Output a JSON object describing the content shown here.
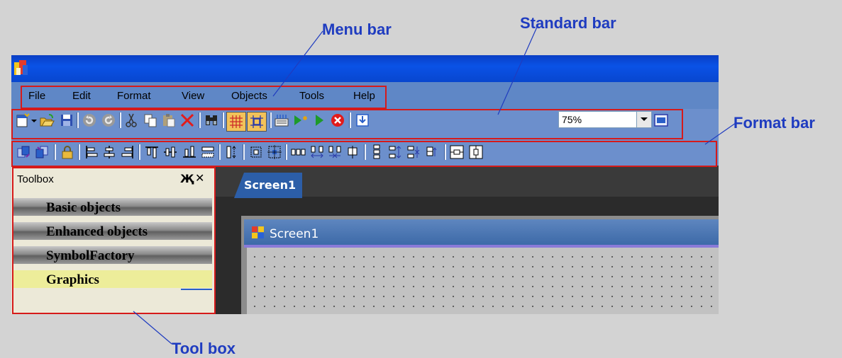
{
  "callouts": {
    "menu_bar": "Menu bar",
    "standard_bar": "Standard bar",
    "format_bar": "Format bar",
    "tool_box": "Tool box"
  },
  "menu": {
    "items": [
      "File",
      "Edit",
      "Format",
      "View",
      "Objects",
      "Tools",
      "Help"
    ]
  },
  "standard_bar": {
    "zoom_value": "75%",
    "icons": [
      "new-screen-icon",
      "dropdown-arrow-icon",
      "open-icon",
      "save-icon",
      "undo-icon",
      "redo-icon",
      "cut-icon",
      "copy-icon",
      "paste-icon",
      "delete-icon",
      "find-icon",
      "grid-icon",
      "snap-icon",
      "build-icon",
      "test-icon",
      "run-icon",
      "stop-icon",
      "transfer-icon",
      "zoom-fit-icon"
    ]
  },
  "format_bar": {
    "icons": [
      "bring-front-icon",
      "send-back-icon",
      "lock-icon",
      "align-left-icon",
      "align-center-icon",
      "align-right-icon",
      "align-top-icon",
      "align-middle-icon",
      "align-bottom-icon",
      "same-width-icon",
      "same-height-icon",
      "same-size-icon",
      "center-icon",
      "space-h-equal-icon",
      "space-h-increase-icon",
      "space-h-decrease-icon",
      "space-h-remove-icon",
      "space-v-equal-icon",
      "space-v-increase-icon",
      "space-v-decrease-icon",
      "space-v-remove-icon",
      "center-h-icon",
      "center-v-icon"
    ]
  },
  "toolbox": {
    "title": "Toolbox",
    "pin": "Җ",
    "close": "✕",
    "categories": [
      "Basic objects",
      "Enhanced objects",
      "SymbolFactory",
      "Graphics"
    ]
  },
  "workspace": {
    "tab": "Screen1",
    "screen_title": "Screen1"
  },
  "colors": {
    "callout": "#1f3cc0",
    "highlight": "#d61a1a",
    "titlebar": "#0a4ad8",
    "toolbar": "#6c8fcc"
  }
}
